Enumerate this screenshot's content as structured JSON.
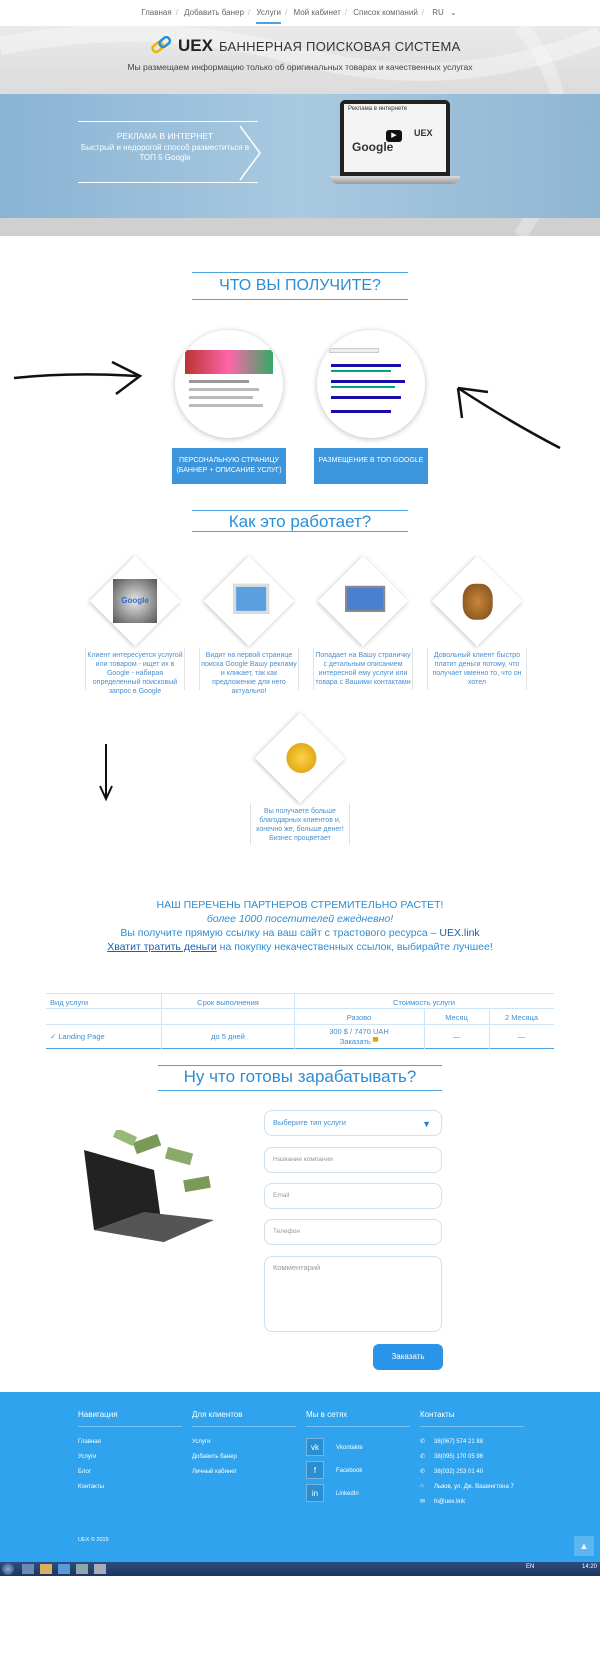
{
  "nav": {
    "items": [
      "Главная",
      "Добавить банер",
      "Услуги",
      "Мой кабинет",
      "Список компаний"
    ],
    "lang": "RU"
  },
  "hero": {
    "logo": "UEX",
    "title": "БАННЕРНАЯ ПОИСКОВАЯ СИСТЕМА",
    "tagline": "Мы размещаем информацию только об оригинальных товарах и качественных услугах",
    "promo_title": "РЕКЛАМА В ИНТЕРНЕТ",
    "promo_text": "Быстрый и недорогой способ разместиться в ТОП 5 Google",
    "video_caption": "Реклама в интернете"
  },
  "get": {
    "title": "ЧТО ВЫ ПОЛУЧИТЕ?",
    "btn1": "ПЕРСОНАЛЬНУЮ СТРАНИЦУ (БАННЕР + ОПИСАНИЕ УСЛУГ)",
    "btn2": "РАЗМЕЩЕНИЕ В ТОП GOOGLE"
  },
  "how": {
    "title": "Как это работает?",
    "steps": [
      "Клиент интересуется услугой или товаром - ищет их в Google - набирая определенный поисковый запрос в Google",
      "Видит на первой странице поиска Google Вашу рекламу и кликает, так как предложение для него актуально!",
      "Попадает на Вашу страничку с детальным описанием интересной ему услуги или товара с Вашими контактами",
      "Довольный клиент быстро платит деньги потому, что получает именно то, что он хотел",
      "Вы получаете больше благодарных клиентов и, конечно же, больше денег! Бизнес процветает"
    ]
  },
  "partners": {
    "line1": "НАШ ПЕРЕЧЕНЬ ПАРТНЕРОВ СТРЕМИТЕЛЬНО РАСТЕТ!",
    "line2": "более 1000 посетителей ежедневно!",
    "line3a": "Вы получите прямую ссылку на ваш сайт с трастового ресурса – ",
    "line3b": "UEX.link",
    "line4a": "Хватит тратить деньги",
    "line4b": " на покупку некачественных ссылок, выбирайте лучшее!"
  },
  "table": {
    "h_service": "Вид услуги",
    "h_term": "Срок выполнения",
    "h_cost": "Стоимость услуги",
    "h_once": "Разово",
    "h_month": "Месяц",
    "h_2month": "2 Месяца",
    "service": "Landing Page",
    "term": "до 5 дней",
    "price": "300 $ / 7470 UAH",
    "order": "Заказать",
    "dash1": "—",
    "dash2": "—"
  },
  "form": {
    "title": "Ну что готовы зарабатывать?",
    "select": "Выберите тип услуги",
    "company": "Название компании",
    "email": "Email",
    "phone": "Телефон",
    "comment": "Комментарий",
    "submit": "Заказать"
  },
  "footer": {
    "nav_h": "Навигация",
    "nav": [
      "Главная",
      "Услуги",
      "Блог",
      "Контакты"
    ],
    "cl_h": "Для клиентов",
    "cl": [
      "Услуги",
      "Добавить банер",
      "Личный кабинет"
    ],
    "soc_h": "Мы в сетях",
    "soc": [
      "Vkontakte",
      "Facebook",
      "LinkedIn"
    ],
    "con_h": "Контакты",
    "con": [
      "38(067) 574 21 88",
      "38(095) 170 05 96",
      "38(032) 253 01 40",
      "Львов, ул. Дж. Вашингтона 7",
      "hi@uex.link"
    ],
    "copy": "UEX © 2015"
  },
  "taskbar": {
    "lang": "EN",
    "time": "14:20"
  }
}
